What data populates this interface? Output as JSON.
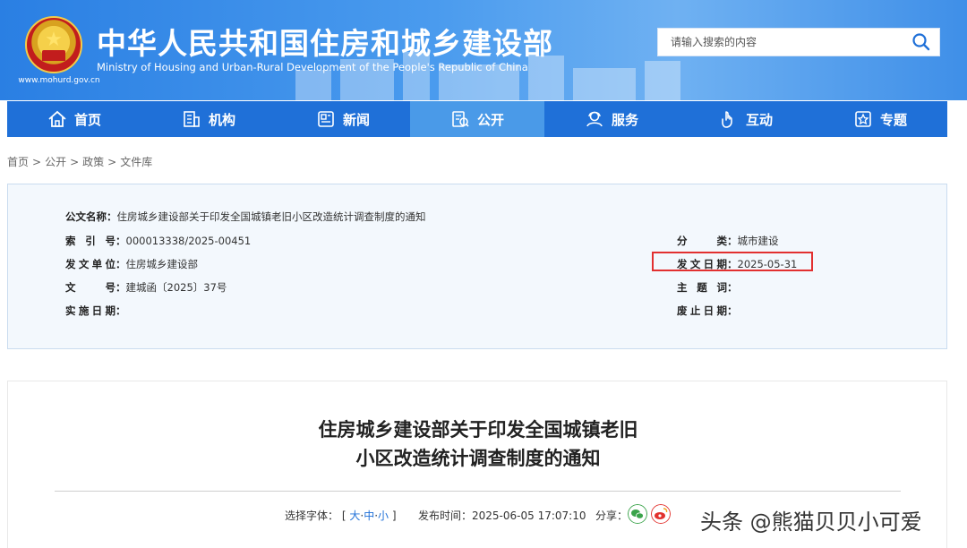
{
  "header": {
    "title_cn": "中华人民共和国住房和城乡建设部",
    "title_en": "Ministry of Housing and Urban-Rural Development of the People's Republic of China",
    "site_url": "www.mohurd.gov.cn",
    "search_placeholder": "请输入搜索的内容",
    "colors": {
      "bg": "#2a7fe3",
      "nav": "#1f70d8",
      "nav_active": "#4a9ae8"
    }
  },
  "nav": [
    {
      "label": "首页",
      "icon": "home-icon"
    },
    {
      "label": "机构",
      "icon": "building-icon"
    },
    {
      "label": "新闻",
      "icon": "news-icon"
    },
    {
      "label": "公开",
      "icon": "disclosure-icon",
      "active": true
    },
    {
      "label": "服务",
      "icon": "service-icon"
    },
    {
      "label": "互动",
      "icon": "interaction-icon"
    },
    {
      "label": "专题",
      "icon": "topic-icon"
    }
  ],
  "breadcrumb": [
    "首页",
    "公开",
    "政策",
    "文件库"
  ],
  "breadcrumb_sep": ">",
  "meta": {
    "doc_name": {
      "label": "公文名称",
      "value": "住房城乡建设部关于印发全国城镇老旧小区改造统计调查制度的通知"
    },
    "index_no": {
      "label": "索引号",
      "value": "000013338/2025-00451"
    },
    "issuer": {
      "label": "发文单位",
      "value": "住房城乡建设部"
    },
    "doc_no": {
      "label": "文号",
      "value": "建城函〔2025〕37号"
    },
    "effective_date": {
      "label": "实施日期",
      "value": ""
    },
    "category": {
      "label": "分类",
      "value": "城市建设"
    },
    "issue_date": {
      "label": "发文日期",
      "value": "2025-05-31"
    },
    "keywords": {
      "label": "主题词",
      "value": ""
    },
    "expiry_date": {
      "label": "废止日期",
      "value": ""
    },
    "highlight_color": "#e23030"
  },
  "article": {
    "title_line1": "住房城乡建设部关于印发全国城镇老旧",
    "title_line2": "小区改造统计调查制度的通知",
    "font_select_label": "选择字体：",
    "font_sizes": [
      "大",
      "中",
      "小"
    ],
    "publish_label": "发布时间：",
    "publish_time": "2025-06-05 17:07:10",
    "share_label": "分享："
  },
  "watermark": "头条 @熊猫贝贝小可爱"
}
